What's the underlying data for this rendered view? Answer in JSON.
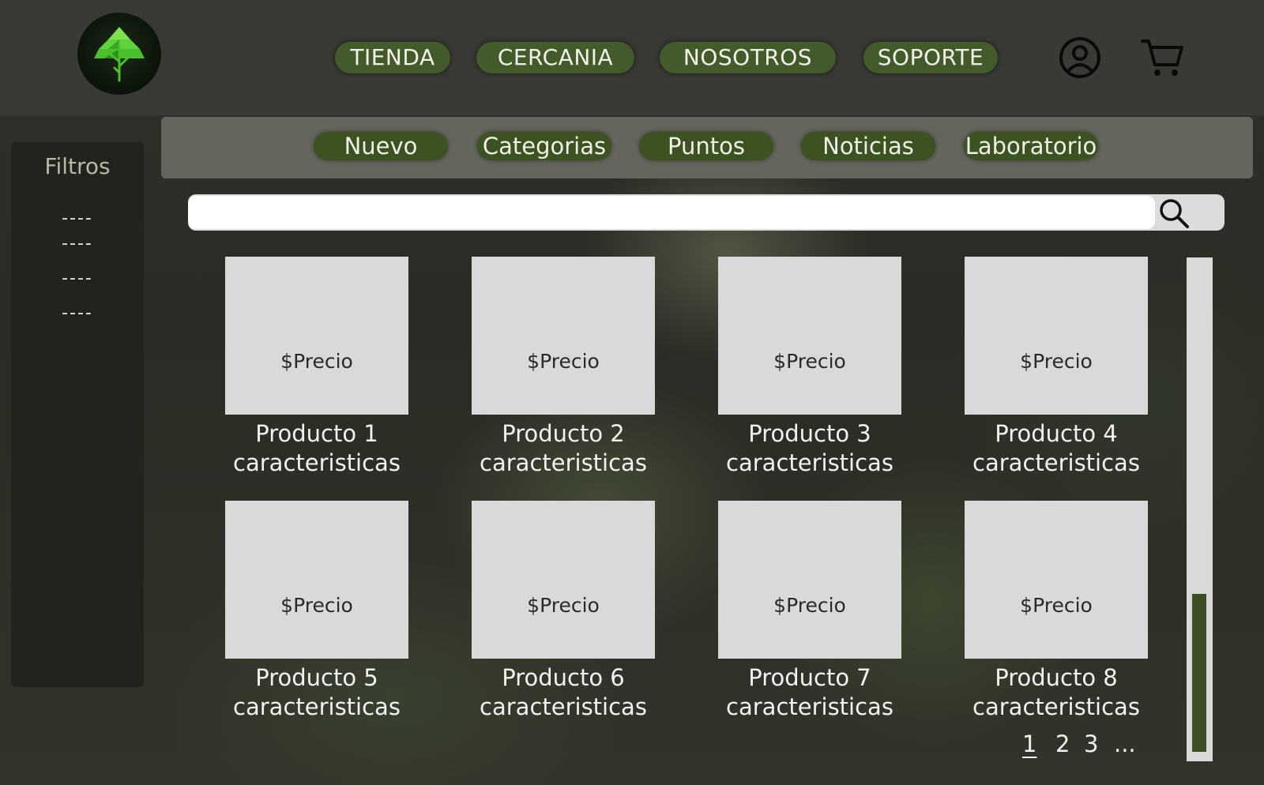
{
  "header": {
    "nav": [
      "TIENDA",
      "CERCANIA",
      "NOSOTROS",
      "SOPORTE"
    ]
  },
  "subnav": [
    "Nuevo",
    "Categorias",
    "Puntos",
    "Noticias",
    "Laboratorio"
  ],
  "sidebar": {
    "title": "Filtros",
    "items": [
      "----",
      "----",
      "----",
      "----"
    ]
  },
  "search": {
    "value": ""
  },
  "products": [
    {
      "price": "$Precio",
      "name": "Producto 1",
      "desc": "caracteristicas"
    },
    {
      "price": "$Precio",
      "name": "Producto 2",
      "desc": "caracteristicas"
    },
    {
      "price": "$Precio",
      "name": "Producto 3",
      "desc": "caracteristicas"
    },
    {
      "price": "$Precio",
      "name": "Producto 4",
      "desc": "caracteristicas"
    },
    {
      "price": "$Precio",
      "name": "Producto 5",
      "desc": "caracteristicas"
    },
    {
      "price": "$Precio",
      "name": "Producto 6",
      "desc": "caracteristicas"
    },
    {
      "price": "$Precio",
      "name": "Producto 7",
      "desc": "caracteristicas"
    },
    {
      "price": "$Precio",
      "name": "Producto 8",
      "desc": "caracteristicas"
    }
  ],
  "pagination": [
    "1",
    "2",
    "3",
    "..."
  ],
  "icons": {
    "logo": "tree-logo-icon",
    "account": "user-icon",
    "cart": "cart-icon",
    "search": "search-icon"
  },
  "colors": {
    "accent_green": "#435a2a",
    "leaf_green": "#5fd43a",
    "topbar": "#393a35"
  }
}
